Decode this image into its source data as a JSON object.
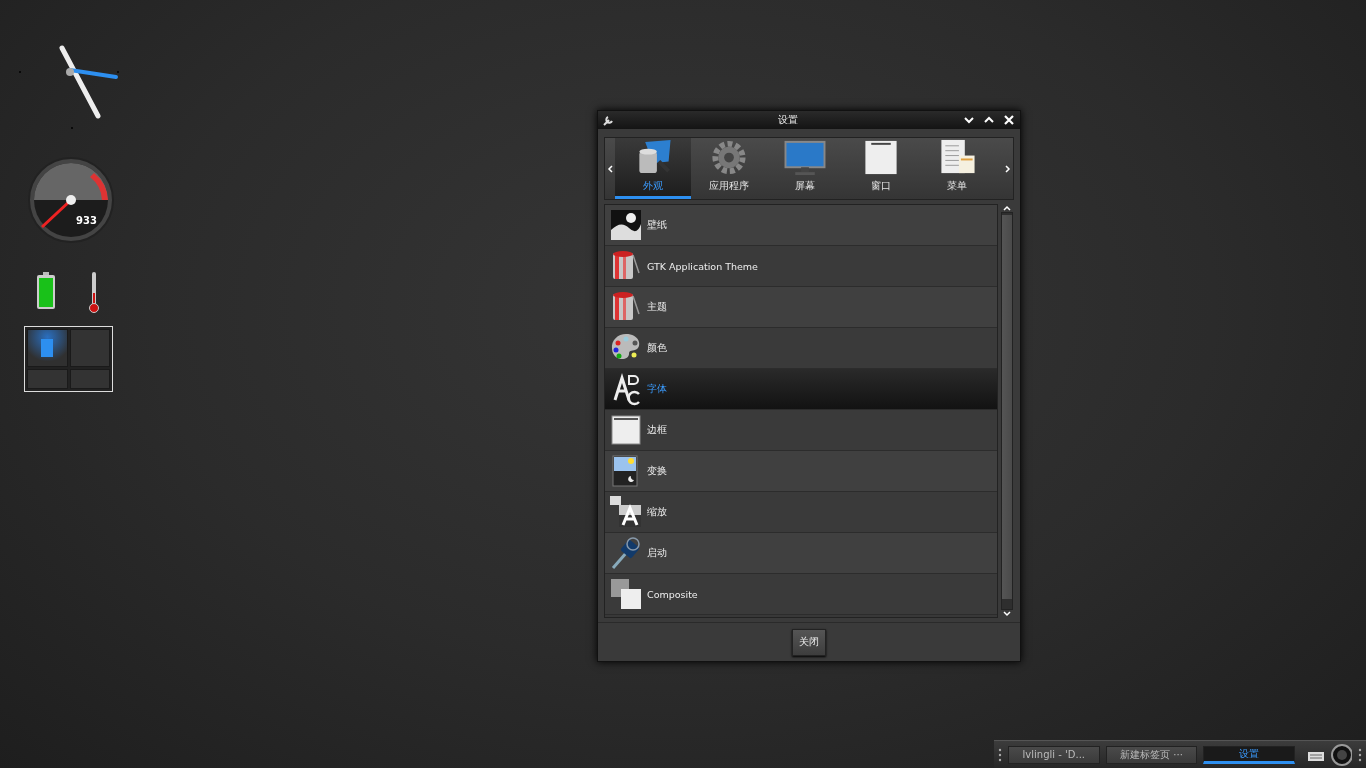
{
  "desktop": {
    "gauge": {
      "reading": "933"
    },
    "pager": [
      {
        "selected": true
      },
      {
        "selected": false
      },
      {
        "selected": false
      },
      {
        "selected": false
      }
    ]
  },
  "window": {
    "title": "设置"
  },
  "categories": [
    {
      "label": "外观",
      "kind": "appearance",
      "selected": true
    },
    {
      "label": "应用程序",
      "kind": "gear",
      "selected": false
    },
    {
      "label": "屏幕",
      "kind": "screen",
      "selected": false
    },
    {
      "label": "窗口",
      "kind": "window",
      "selected": false
    },
    {
      "label": "菜单",
      "kind": "menu",
      "selected": false
    }
  ],
  "items": [
    {
      "label": "壁纸",
      "kind": "wallpaper",
      "selected": false
    },
    {
      "label": "GTK Application Theme",
      "kind": "paint",
      "selected": false
    },
    {
      "label": "主题",
      "kind": "paint",
      "selected": false
    },
    {
      "label": "颜色",
      "kind": "palette",
      "selected": false
    },
    {
      "label": "字体",
      "kind": "font",
      "selected": true
    },
    {
      "label": "边框",
      "kind": "border",
      "selected": false
    },
    {
      "label": "变换",
      "kind": "transform",
      "selected": false
    },
    {
      "label": "缩放",
      "kind": "scale",
      "selected": false
    },
    {
      "label": "启动",
      "kind": "launch",
      "selected": false
    },
    {
      "label": "Composite",
      "kind": "composite",
      "selected": false
    }
  ],
  "buttons": [
    "关闭"
  ],
  "taskbar": {
    "tasks": [
      {
        "label": "lvlingli - 'D...",
        "selected": false
      },
      {
        "label": "新建标签页 ···",
        "selected": false
      },
      {
        "label": "设置",
        "selected": true
      }
    ]
  }
}
